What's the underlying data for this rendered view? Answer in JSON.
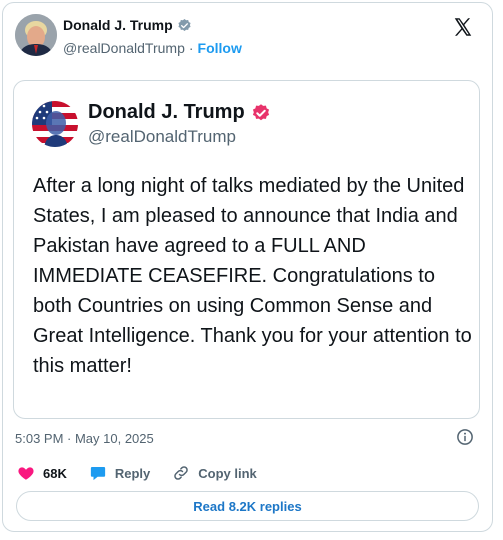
{
  "author": {
    "name": "Donald J. Trump",
    "handle": "@realDonaldTrump",
    "separator": "·",
    "follow_label": "Follow"
  },
  "embedded_post": {
    "name": "Donald J. Trump",
    "handle": "@realDonaldTrump",
    "text": "After a long night of talks mediated by the United States, I am pleased to announce that India and Pakistan have agreed to a FULL AND IMMEDIATE CEASEFIRE. Congratulations to both Countries on using Common Sense and Great Intelligence. Thank you for your attention to this matter!"
  },
  "timestamp": "5:03 PM · May 10, 2025",
  "actions": {
    "like_count": "68K",
    "reply_label": "Reply",
    "copy_link_label": "Copy link"
  },
  "read_replies_label": "Read 8.2K replies",
  "colors": {
    "accent_blue": "#1d9bf0",
    "like_pink": "#f91880",
    "verified_pink": "#e8336b",
    "muted": "#536471",
    "border": "#cfd9de"
  },
  "icons": [
    "verified-badge-icon",
    "x-logo-icon",
    "info-icon",
    "heart-icon",
    "reply-bubble-icon",
    "link-icon"
  ]
}
